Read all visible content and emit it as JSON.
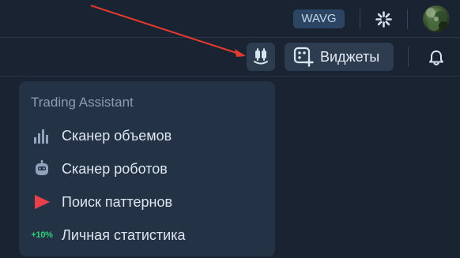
{
  "top_bar": {
    "ticker_badge": "WAVG"
  },
  "toolbar": {
    "widgets_label": "Виджеты"
  },
  "dropdown": {
    "title": "Trading Assistant",
    "items": [
      {
        "label": "Сканер объемов",
        "icon": "bar-chart-icon"
      },
      {
        "label": "Сканер роботов",
        "icon": "robot-icon"
      },
      {
        "label": "Поиск паттернов",
        "icon": "play-triangle-icon"
      },
      {
        "label": "Личная статистика",
        "icon": "percent-badge-icon",
        "icon_text": "+10%"
      }
    ]
  },
  "colors": {
    "background": "#1a2332",
    "button_bg": "#2e3c50",
    "dropdown_bg": "#243245",
    "accent_red": "#e8414a",
    "accent_green": "#2fd17a",
    "badge_bg": "#2c4562"
  }
}
